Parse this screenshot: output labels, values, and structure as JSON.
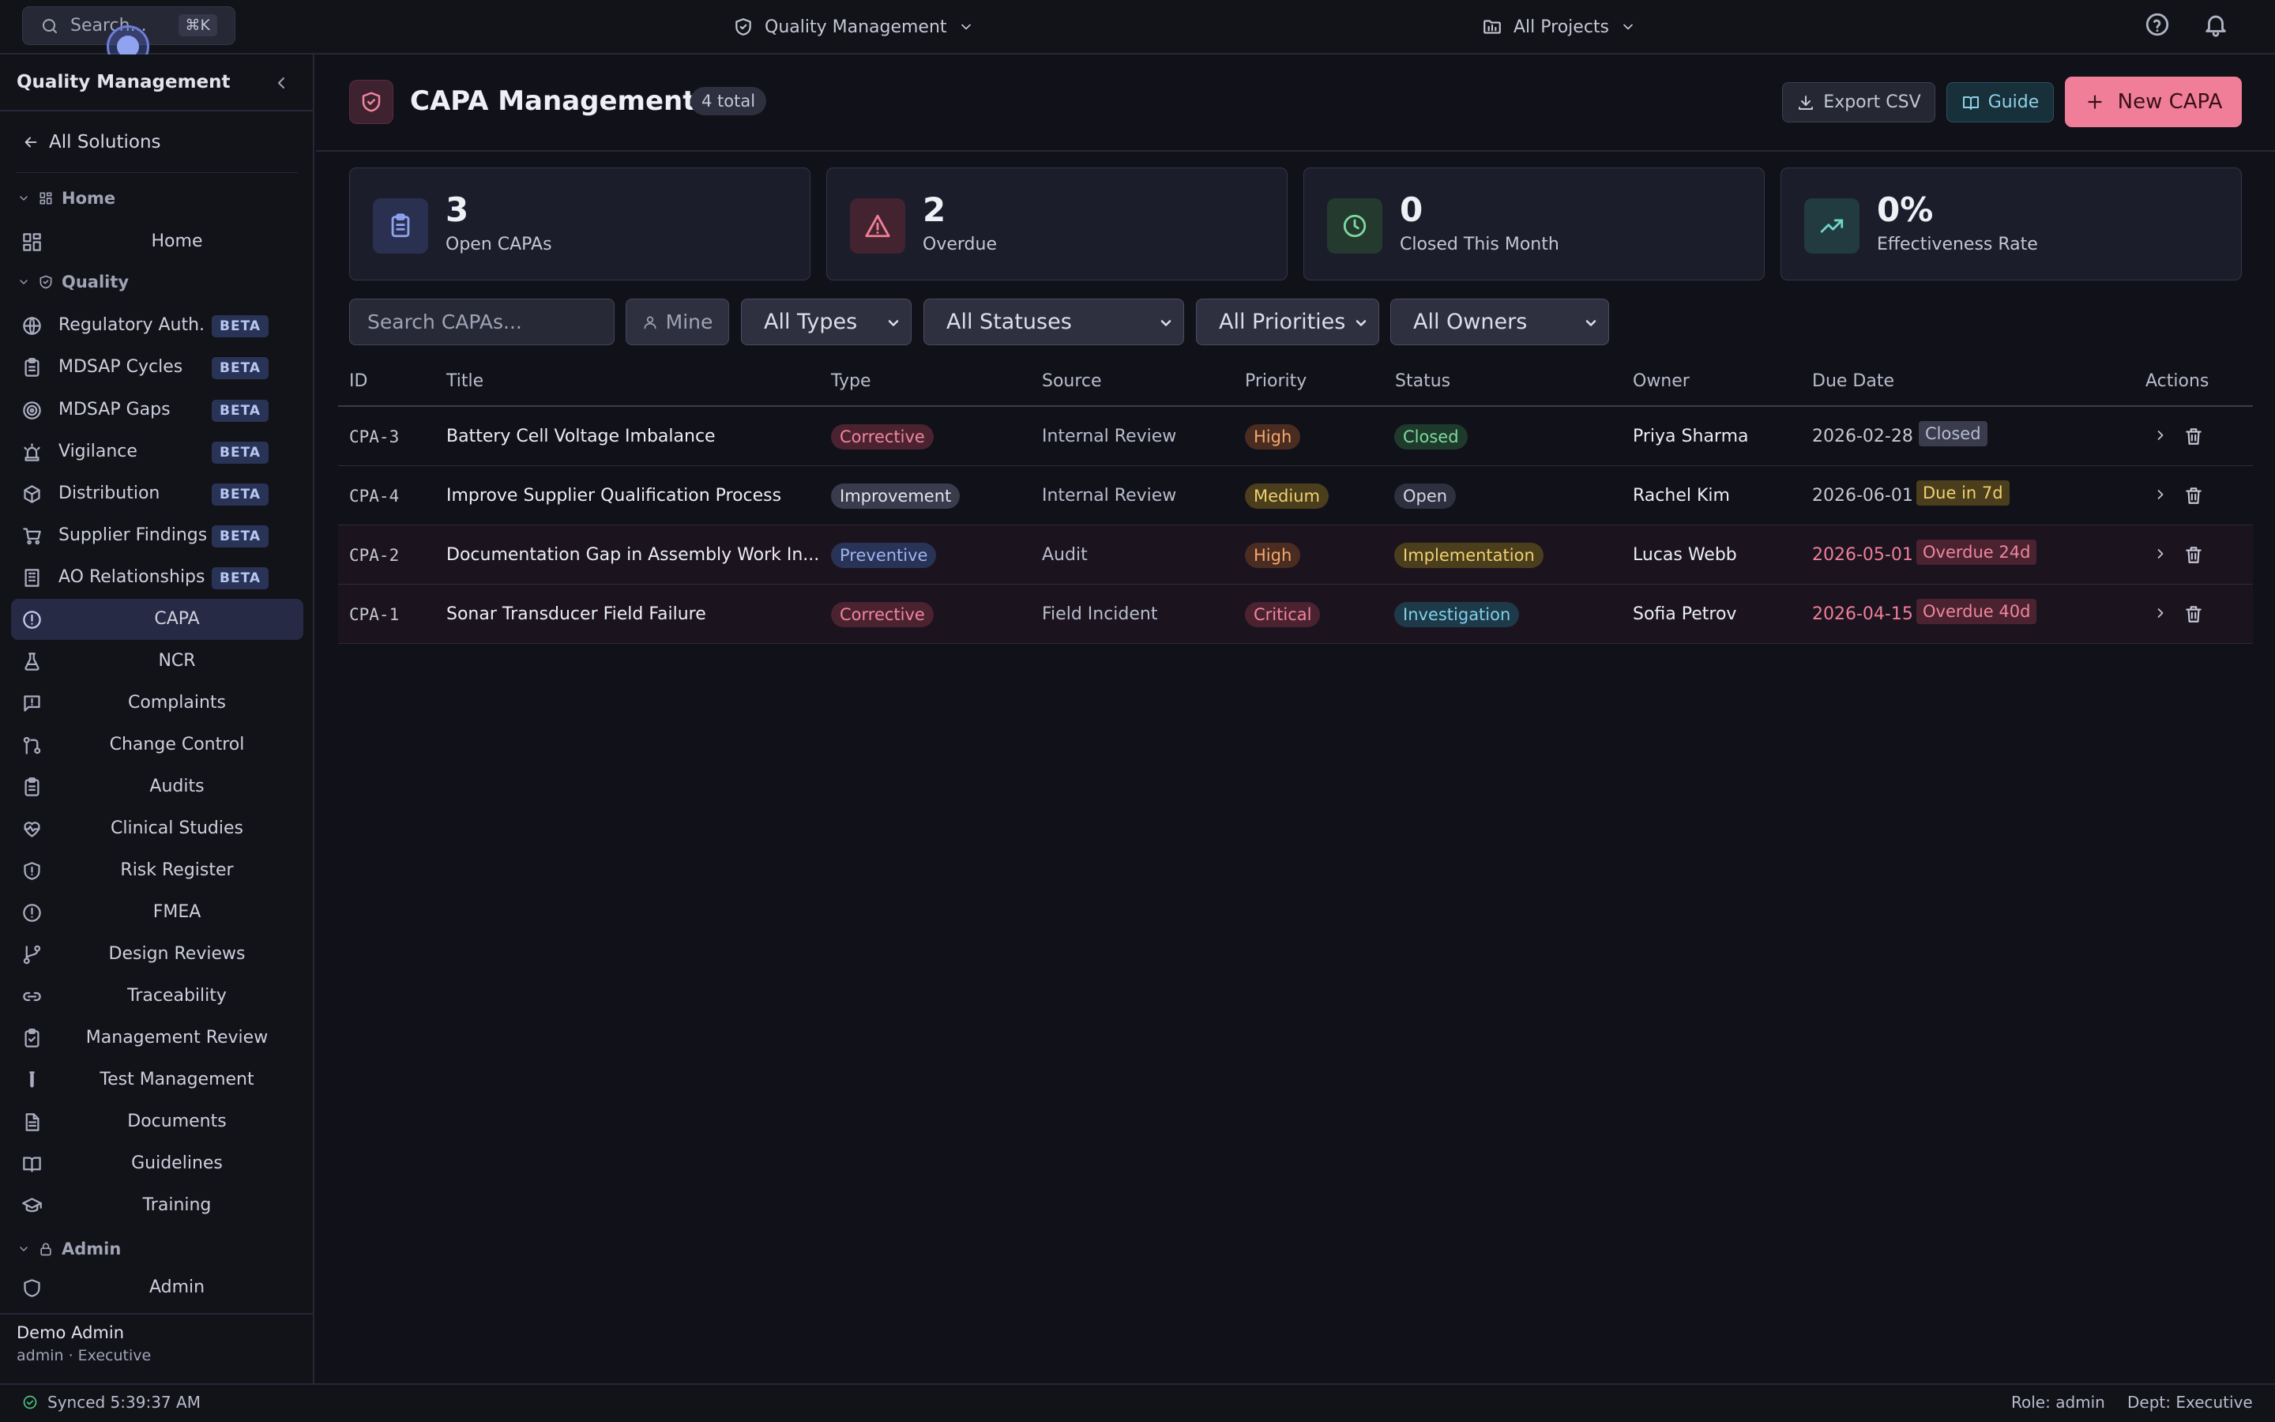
{
  "topbar": {
    "search_placeholder": "Search...",
    "search_shortcut": "⌘K",
    "solution_label": "Quality Management",
    "project_label": "All Projects"
  },
  "sidebar": {
    "title": "Quality Management",
    "back_label": "All Solutions",
    "sections": {
      "home": "Home",
      "quality": "Quality",
      "admin": "Admin"
    },
    "items": [
      {
        "label": "Home",
        "icon": "dashboard-icon"
      },
      {
        "label": "Regulatory Auth.",
        "icon": "globe-icon",
        "badge": "BETA"
      },
      {
        "label": "MDSAP Cycles",
        "icon": "clipboard-icon",
        "badge": "BETA"
      },
      {
        "label": "MDSAP Gaps",
        "icon": "target-icon",
        "badge": "BETA"
      },
      {
        "label": "Vigilance",
        "icon": "siren-icon",
        "badge": "BETA"
      },
      {
        "label": "Distribution",
        "icon": "package-icon",
        "badge": "BETA"
      },
      {
        "label": "Supplier Findings",
        "icon": "cart-icon",
        "badge": "BETA"
      },
      {
        "label": "AO Relationships",
        "icon": "building-icon",
        "badge": "BETA"
      },
      {
        "label": "CAPA",
        "icon": "alert-circle-icon",
        "active": true
      },
      {
        "label": "NCR",
        "icon": "flask-icon"
      },
      {
        "label": "Complaints",
        "icon": "message-alert-icon"
      },
      {
        "label": "Change Control",
        "icon": "git-pull-request-icon"
      },
      {
        "label": "Audits",
        "icon": "clipboard-list-icon"
      },
      {
        "label": "Clinical Studies",
        "icon": "heart-pulse-icon"
      },
      {
        "label": "Risk Register",
        "icon": "shield-alert-icon"
      },
      {
        "label": "FMEA",
        "icon": "alert-circle-icon"
      },
      {
        "label": "Design Reviews",
        "icon": "git-branch-icon"
      },
      {
        "label": "Traceability",
        "icon": "link-icon"
      },
      {
        "label": "Management Review",
        "icon": "clipboard-check-icon"
      },
      {
        "label": "Test Management",
        "icon": "test-tube-icon"
      },
      {
        "label": "Documents",
        "icon": "file-text-icon"
      },
      {
        "label": "Guidelines",
        "icon": "book-open-icon"
      },
      {
        "label": "Training",
        "icon": "graduation-cap-icon"
      },
      {
        "label": "Admin",
        "icon": "shield-icon"
      }
    ],
    "user": {
      "name": "Demo Admin",
      "role": "admin · Executive"
    }
  },
  "header": {
    "title": "CAPA Management",
    "total_badge": "4 total",
    "export_label": "Export CSV",
    "guide_label": "Guide",
    "new_label": "New CAPA"
  },
  "stats": [
    {
      "value": "3",
      "label": "Open CAPAs",
      "icon": "clipboard-icon",
      "color": "#7b8ff0"
    },
    {
      "value": "2",
      "label": "Overdue",
      "icon": "alert-triangle-icon",
      "color": "#f07e98"
    },
    {
      "value": "0",
      "label": "Closed This Month",
      "icon": "clock-icon",
      "color": "#5fcf8c"
    },
    {
      "value": "0%",
      "label": "Effectiveness Rate",
      "icon": "trending-up-icon",
      "color": "#4fc7c0"
    }
  ],
  "filters": {
    "search_placeholder": "Search CAPAs...",
    "mine_label": "Mine",
    "type": "All Types",
    "status": "All Statuses",
    "priority": "All Priorities",
    "owner": "All Owners"
  },
  "table": {
    "columns": [
      "ID",
      "Title",
      "Type",
      "Source",
      "Priority",
      "Status",
      "Owner",
      "Due Date",
      "Actions"
    ],
    "rows": [
      {
        "id": "CPA-3",
        "title": "Battery Cell Voltage Imbalance",
        "type": "Corrective",
        "source": "Internal Review",
        "priority": "High",
        "status": "Closed",
        "owner": "Priya Sharma",
        "due_date": "2026-02-28",
        "due_badge": "Closed",
        "overdue": false
      },
      {
        "id": "CPA-4",
        "title": "Improve Supplier Qualification Process",
        "type": "Improvement",
        "source": "Internal Review",
        "priority": "Medium",
        "status": "Open",
        "owner": "Rachel Kim",
        "due_date": "2026-06-01",
        "due_badge": "Due in 7d",
        "overdue": false
      },
      {
        "id": "CPA-2",
        "title": "Documentation Gap in Assembly Work In...",
        "type": "Preventive",
        "source": "Audit",
        "priority": "High",
        "status": "Implementation",
        "owner": "Lucas Webb",
        "due_date": "2026-05-01",
        "due_badge": "Overdue 24d",
        "overdue": true
      },
      {
        "id": "CPA-1",
        "title": "Sonar Transducer Field Failure",
        "type": "Corrective",
        "source": "Field Incident",
        "priority": "Critical",
        "status": "Investigation",
        "owner": "Sofia Petrov",
        "due_date": "2026-04-15",
        "due_badge": "Overdue 40d",
        "overdue": true
      }
    ]
  },
  "pill_colors": {
    "Corrective": {
      "bg": "#4a2230",
      "fg": "#f0869e"
    },
    "Improvement": {
      "bg": "#3a3c4e",
      "fg": "#e2e4ec"
    },
    "Preventive": {
      "bg": "#283356",
      "fg": "#9fb3f4"
    },
    "High": {
      "bg": "#4a2c20",
      "fg": "#f5a870"
    },
    "Medium": {
      "bg": "#4a3e1c",
      "fg": "#f0d070"
    },
    "Critical": {
      "bg": "#4a2230",
      "fg": "#f0869e"
    },
    "Closed": {
      "bg": "#1e3a2a",
      "fg": "#7ed9a0"
    },
    "Open": {
      "bg": "#2e3040",
      "fg": "#d4d7e2"
    },
    "Implementation": {
      "bg": "#4a3e1c",
      "fg": "#f0d070"
    },
    "Investigation": {
      "bg": "#1e3a48",
      "fg": "#7fcfe8"
    }
  },
  "statusbar": {
    "sync_text": "Synced 5:39:37 AM",
    "role_text": "Role: admin",
    "dept_text": "Dept: Executive"
  }
}
